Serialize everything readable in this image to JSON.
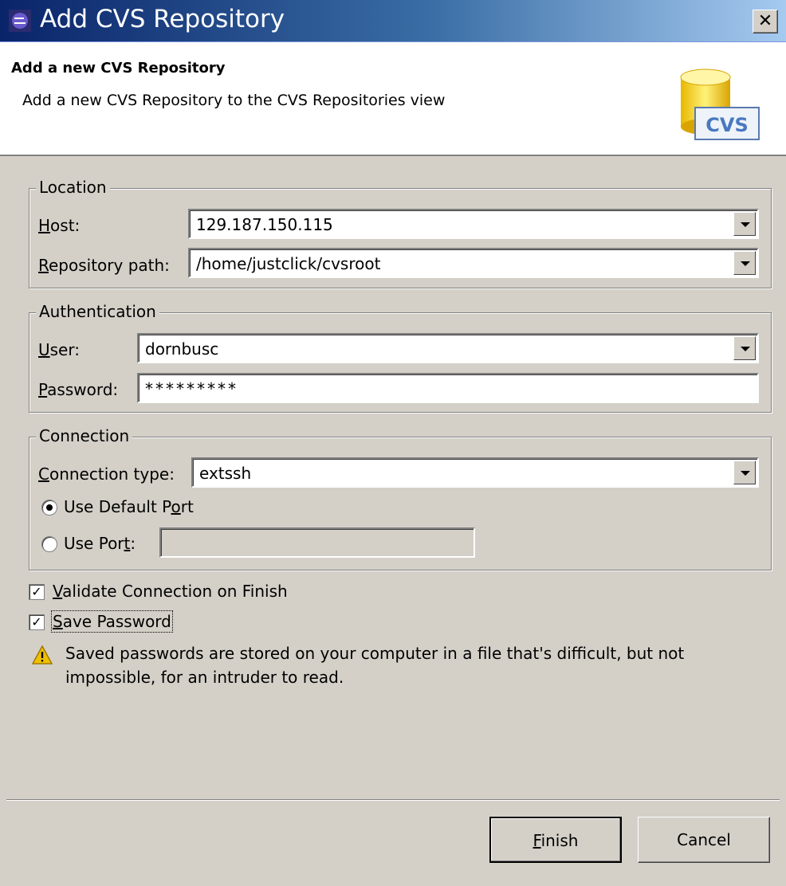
{
  "window": {
    "title": "Add CVS Repository",
    "close_glyph": "✕"
  },
  "header": {
    "title": "Add a new CVS Repository",
    "description": "Add a new CVS Repository to the CVS Repositories view",
    "icon": "cvs-repository-icon",
    "icon_text": "CVS"
  },
  "location": {
    "legend": "Location",
    "host_label": "Host:",
    "host_value": "129.187.150.115",
    "path_label": "Repository path:",
    "path_value": "/home/justclick/cvsroot"
  },
  "authentication": {
    "legend": "Authentication",
    "user_label": "User:",
    "user_value": "dornbusc",
    "password_label": "Password:",
    "password_value": "*********"
  },
  "connection": {
    "legend": "Connection",
    "type_label": "Connection type:",
    "type_value": "extssh",
    "default_port_label": "Use Default Port",
    "default_port_selected": true,
    "use_port_label": "Use Port:",
    "use_port_value": ""
  },
  "options": {
    "validate_label": "Validate Connection on Finish",
    "validate_checked": true,
    "save_password_label": "Save Password",
    "save_password_checked": true
  },
  "warning": {
    "text": "Saved passwords are stored on your computer in a file that's difficult, but not impossible, for an intruder to read."
  },
  "buttons": {
    "finish": "Finish",
    "cancel": "Cancel"
  },
  "colors": {
    "dialog_bg": "#d4d0c8",
    "title_start": "#0a246a",
    "title_end": "#a6caf0",
    "warning": "#f0c000"
  }
}
